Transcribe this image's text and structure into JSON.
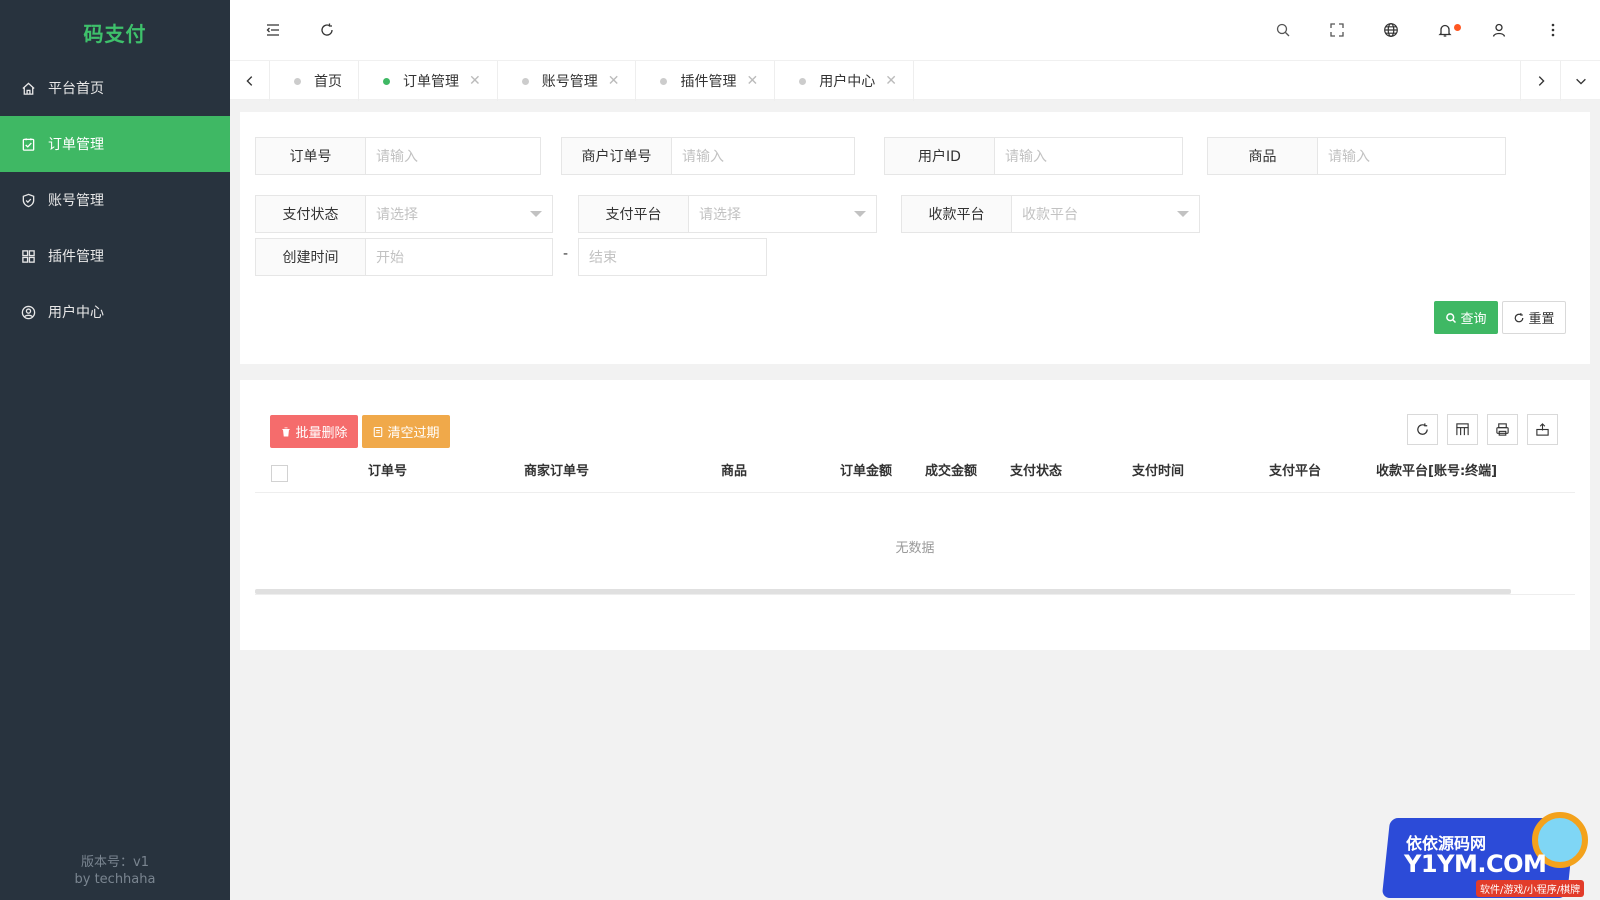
{
  "app": {
    "logo": "码支付",
    "version_line1": "版本号：v1",
    "version_line2": "by techhaha"
  },
  "sidebar": {
    "items": [
      {
        "label": "平台首页",
        "icon": "home-icon"
      },
      {
        "label": "订单管理",
        "icon": "clipboard-check-icon",
        "active": true
      },
      {
        "label": "账号管理",
        "icon": "shield-check-icon"
      },
      {
        "label": "插件管理",
        "icon": "grid-icon"
      },
      {
        "label": "用户中心",
        "icon": "user-circle-icon"
      }
    ]
  },
  "header": {
    "icons": [
      "menu-fold-icon",
      "refresh-icon",
      "search-icon",
      "fullscreen-icon",
      "globe-icon",
      "bell-icon",
      "user-icon",
      "more-vertical-icon"
    ]
  },
  "tabs": [
    {
      "label": "首页",
      "closable": false
    },
    {
      "label": "订单管理",
      "closable": true,
      "active": true
    },
    {
      "label": "账号管理",
      "closable": true
    },
    {
      "label": "插件管理",
      "closable": true
    },
    {
      "label": "用户中心",
      "closable": true
    }
  ],
  "search": {
    "order_no": {
      "label": "订单号",
      "placeholder": "请输入"
    },
    "merchant_order_no": {
      "label": "商户订单号",
      "placeholder": "请输入"
    },
    "user_id": {
      "label": "用户ID",
      "placeholder": "请输入"
    },
    "goods": {
      "label": "商品",
      "placeholder": "请输入"
    },
    "pay_status": {
      "label": "支付状态",
      "placeholder": "请选择"
    },
    "pay_platform": {
      "label": "支付平台",
      "placeholder": "请选择"
    },
    "receive_platform": {
      "label": "收款平台",
      "placeholder": "收款平台"
    },
    "created_time": {
      "label": "创建时间",
      "start_placeholder": "开始",
      "end_placeholder": "结束",
      "separator": "-"
    },
    "query_label": "查询",
    "reset_label": "重置"
  },
  "table": {
    "batch_delete_label": "批量删除",
    "clear_expired_label": "清空过期",
    "columns": [
      "订单号",
      "商家订单号",
      "商品",
      "订单金额",
      "成交金额",
      "支付状态",
      "支付时间",
      "支付平台",
      "收款平台[账号:终端]"
    ],
    "empty_text": "无数据"
  },
  "watermark": {
    "line1": "依依源码网",
    "line2": "Y1YM.COM",
    "line3": "软件/游戏/小程序/棋牌"
  },
  "colors": {
    "accent": "#3fb864",
    "sidebar_bg": "#28333e",
    "danger": "#f56c6c",
    "warning": "#f0a94a"
  }
}
